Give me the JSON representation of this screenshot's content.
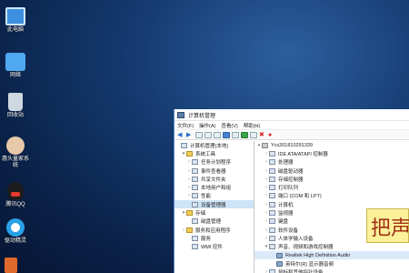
{
  "desktop": {
    "icons": [
      {
        "label": "此电脑",
        "icon": "computer-icon"
      },
      {
        "label": "网络",
        "icon": "network-icon"
      },
      {
        "label": "回收站",
        "icon": "recycle-bin-icon"
      },
      {
        "label": "惠头童家系统",
        "icon": "avatar-icon"
      },
      {
        "label": "腾讯QQ",
        "icon": "qq-icon"
      },
      {
        "label": "驱动精灵",
        "icon": "driver-icon"
      }
    ]
  },
  "window": {
    "title": "计算机管理",
    "menu": [
      "文件(F)",
      "操作(A)",
      "查看(V)",
      "帮助(H)"
    ],
    "left_tree": [
      {
        "label": "计算机管理(本地)",
        "level": 0,
        "caret": "",
        "icon": "computer-mgmt-icon"
      },
      {
        "label": "系统工具",
        "level": 1,
        "caret": "▾",
        "icon": "tools-icon"
      },
      {
        "label": "任务计划程序",
        "level": 2,
        "caret": "›",
        "icon": "task-scheduler-icon"
      },
      {
        "label": "事件查看器",
        "level": 2,
        "caret": "›",
        "icon": "event-viewer-icon"
      },
      {
        "label": "共享文件夹",
        "level": 2,
        "caret": "›",
        "icon": "shared-folder-icon"
      },
      {
        "label": "本地用户和组",
        "level": 2,
        "caret": "›",
        "icon": "users-icon"
      },
      {
        "label": "性能",
        "level": 2,
        "caret": "›",
        "icon": "performance-icon"
      },
      {
        "label": "设备管理器",
        "level": 2,
        "caret": "",
        "icon": "device-manager-icon",
        "selected": true
      },
      {
        "label": "存储",
        "level": 1,
        "caret": "▾",
        "icon": "storage-icon"
      },
      {
        "label": "磁盘管理",
        "level": 2,
        "caret": "",
        "icon": "disk-icon"
      },
      {
        "label": "服务和应用程序",
        "level": 1,
        "caret": "›",
        "icon": "services-icon"
      },
      {
        "label": "服务",
        "level": 2,
        "caret": "",
        "icon": "service-icon"
      },
      {
        "label": "WMI 控件",
        "level": 2,
        "caret": "",
        "icon": "wmi-icon"
      }
    ],
    "device_tree": [
      {
        "label": "Ycs201810291339",
        "level": 0,
        "caret": "▾"
      },
      {
        "label": "IDE ATA/ATAPI 控制器",
        "level": 1,
        "caret": "›"
      },
      {
        "label": "处理器",
        "level": 1,
        "caret": "›"
      },
      {
        "label": "磁盘驱动器",
        "level": 1,
        "caret": "›"
      },
      {
        "label": "存储控制器",
        "level": 1,
        "caret": "›"
      },
      {
        "label": "打印队列",
        "level": 1,
        "caret": "›"
      },
      {
        "label": "端口 (COM 和 LPT)",
        "level": 1,
        "caret": "›"
      },
      {
        "label": "计算机",
        "level": 1,
        "caret": "›"
      },
      {
        "label": "监视器",
        "level": 1,
        "caret": "›"
      },
      {
        "label": "键盘",
        "level": 1,
        "caret": "›"
      },
      {
        "label": "软件设备",
        "level": 1,
        "caret": "›"
      },
      {
        "label": "人体学输入设备",
        "level": 1,
        "caret": "›"
      },
      {
        "label": "声音、视频和游戏控制器",
        "level": 1,
        "caret": "▾"
      },
      {
        "label": "Realtek High Definition Audio",
        "level": 2,
        "caret": "",
        "highlight": true
      },
      {
        "label": "英特尔(R) 显示器音频",
        "level": 2,
        "caret": ""
      },
      {
        "label": "鼠标和其他指针设备",
        "level": 1,
        "caret": "›"
      }
    ]
  },
  "overlay": {
    "text": "把声"
  }
}
